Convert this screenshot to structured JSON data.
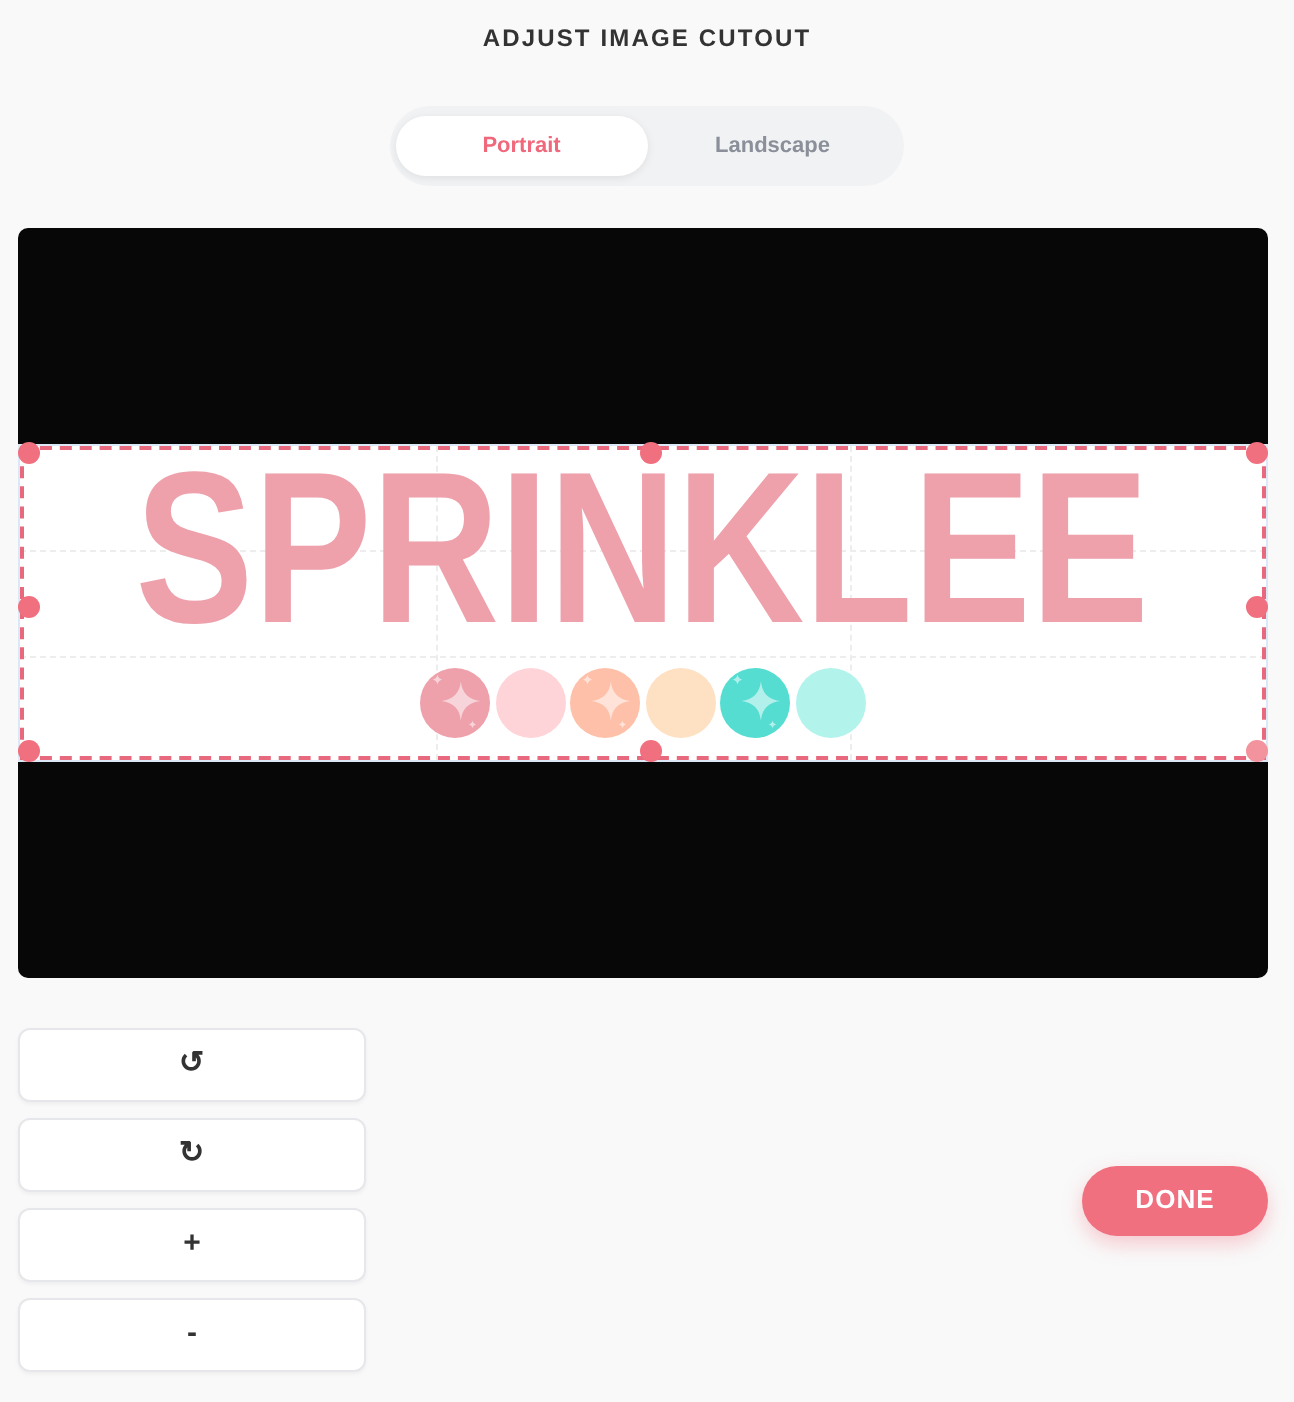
{
  "title": "ADJUST IMAGE CUTOUT",
  "tabs": [
    {
      "label": "Portrait",
      "selected": true
    },
    {
      "label": "Landscape",
      "selected": false
    }
  ],
  "image": {
    "logo_text": "SPRINKLEE",
    "dots": [
      {
        "kind": "sparkle",
        "color": "#eea0ab"
      },
      {
        "kind": "plain",
        "color": "#fed4d8"
      },
      {
        "kind": "sparkle",
        "color": "#fec0a8"
      },
      {
        "kind": "plain",
        "color": "#fee0c3"
      },
      {
        "kind": "sparkle",
        "color": "#56ddd2"
      },
      {
        "kind": "plain",
        "color": "#b2f3ec"
      }
    ]
  },
  "tools": [
    {
      "label": "↺"
    },
    {
      "label": "↻"
    },
    {
      "label": "+"
    },
    {
      "label": "-"
    }
  ],
  "done_button": {
    "label": "DONE"
  }
}
